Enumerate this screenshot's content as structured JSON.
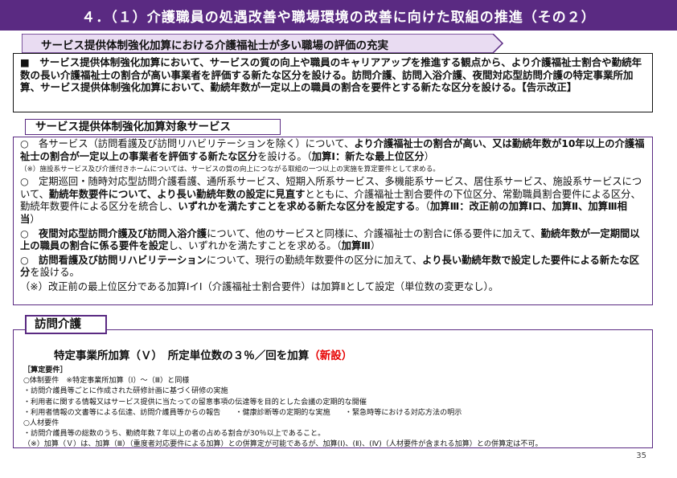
{
  "title": "４．（１）介護職員の処遇改善や職場環境の改善に向けた取組の推進（その２）",
  "section1": {
    "banner": "サービス提供体制強化加算における介護福祉士が多い職場の評価の充実",
    "body": "■　サービス提供体制強化加算において、サービスの質の向上や職員のキャリアアップを推進する観点から、より介護福祉士割合や勤続年数の長い介護福祉士の割合が高い事業者を評価する新たな区分を設ける。訪問介護、訪問入浴介護、夜間対応型訪問介護の特定事業所加算、サービス提供体制強化加算において、勤続年数が一定以上の職員の割合を要件とする新たな区分を設ける。【告示改正】"
  },
  "section2": {
    "label": "サービス提供体制強化加算対象サービス",
    "item1": {
      "a": "○　各サービス（訪問看護及び訪問リハビリテーションを除く）について、",
      "b": "より介護福祉士の割合が高い、又は勤続年数が10年以上の介護福祉士の割合が一定以上の事業者を評価する新たな区分",
      "c": "を設ける。（",
      "d": "加算Ⅰ：新たな最上位区分",
      "e": "）"
    },
    "note1": "（※）施設系サービス及び介護付きホームについては、サービスの質の向上につながる取組の一つ以上の実施を算定要件として求める。",
    "item2": {
      "a": "○　定期巡回・随時対応型訪問介護看護、通所系サービス、短期入所系サービス、多機能系サービス、居住系サービス、施設系サービスについて、",
      "b": "勤続年数要件について、より長い勤続年数の設定に見直す",
      "c": "とともに、介護福祉士割合要件の下位区分、常勤職員割合要件による区分、勤続年数要件による区分を統合し、",
      "d": "いずれかを満たすことを求める新たな区分を設定する",
      "e": "。（",
      "f": "加算Ⅲ：改正前の加算Ⅰロ、加算Ⅱ、加算Ⅲ相当",
      "g": "）"
    },
    "item3": {
      "a": "○　",
      "b": "夜間対応型訪問介護及び訪問入浴介護",
      "c": "について、他のサービスと同様に、介護福祉士の割合に係る要件に加えて、",
      "d": "勤続年数が一定期間以上の職員の割合に係る要件を設定",
      "e": "し、いずれかを満たすことを求める。（",
      "f": "加算Ⅲ",
      "g": "）"
    },
    "item4": {
      "a": "○　",
      "b": "訪問看護及び訪問リハビリテーション",
      "c": "について、現行の勤続年数要件の区分に加えて、",
      "d": "より長い勤続年数で設定した要件による新たな区分",
      "e": "を設ける。"
    },
    "note2": "（※）改正前の最上位区分である加算ⅠイⅠ（介護福祉士割合要件）は加算Ⅱとして設定（単位数の変更なし）。"
  },
  "section3": {
    "label": "訪問介護",
    "headline_a": "特定事業所加算（Ｖ）　所定単位数の３％／回を加算",
    "headline_b": "（新設）",
    "req_title": "［算定要件］",
    "lines": [
      "○体制要件　※特定事業所加算（Ⅰ）～（Ⅲ）と同様",
      "・訪問介護員等ごとに作成された研修計画に基づく研修の実施",
      "・利用者に関する情報又はサービス提供に当たっての留意事項の伝達等を目的とした会議の定期的な開催",
      "・利用者情報の文書等による伝達、訪問介護員等からの報告　　・健康診断等の定期的な実施　　・緊急時等における対応方法の明示",
      "○人材要件",
      "・訪問介護員等の総数のうち、勤続年数７年以上の者の占める割合が30％以上であること。",
      "（※）加算（Ｖ）は、加算（Ⅲ）（重度者対応要件による加算）との併算定が可能であるが、加算(Ⅰ)、(Ⅱ)、(Ⅳ)（人材要件が含まれる加算）との併算定は不可。"
    ]
  },
  "page_number": "35",
  "colors": {
    "accent": "#5a2a82",
    "highlight": "#e60000"
  }
}
